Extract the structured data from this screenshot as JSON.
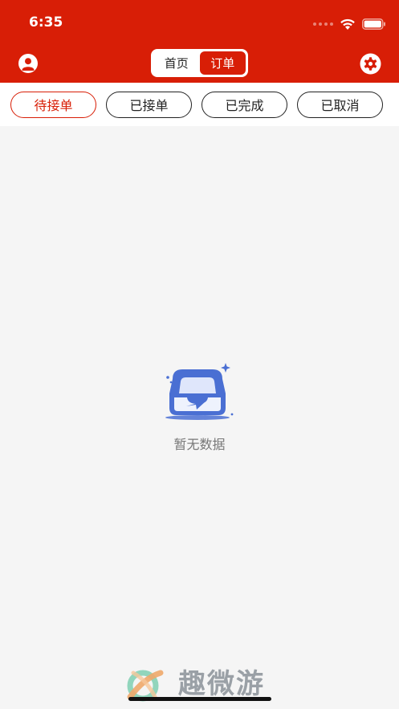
{
  "status_bar": {
    "time": "6:35"
  },
  "header": {
    "tabs": [
      {
        "label": "首页",
        "active": false
      },
      {
        "label": "订单",
        "active": true
      }
    ]
  },
  "filters": [
    {
      "label": "待接单",
      "active": true
    },
    {
      "label": "已接单",
      "active": false
    },
    {
      "label": "已完成",
      "active": false
    },
    {
      "label": "已取消",
      "active": false
    }
  ],
  "empty_state": {
    "text": "暂无数据",
    "icon": "empty-inbox-icon"
  },
  "watermark": {
    "text": "趣微游",
    "logo": "quweiyou-logo"
  },
  "colors": {
    "brand": "#d81e06",
    "background": "#f5f5f5",
    "empty_icon": "#4a6fd3"
  }
}
